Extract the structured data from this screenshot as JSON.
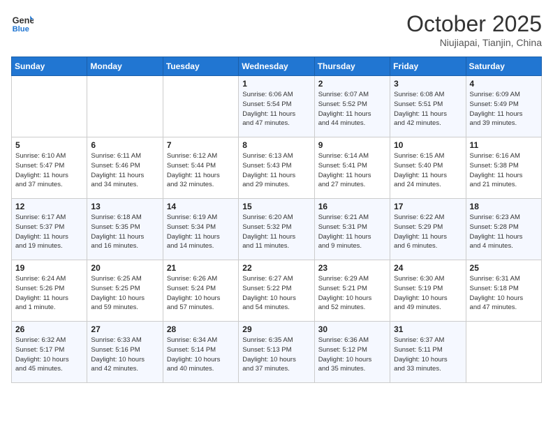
{
  "header": {
    "logo_line1": "General",
    "logo_line2": "Blue",
    "month_title": "October 2025",
    "subtitle": "Niujiapai, Tianjin, China"
  },
  "days_of_week": [
    "Sunday",
    "Monday",
    "Tuesday",
    "Wednesday",
    "Thursday",
    "Friday",
    "Saturday"
  ],
  "weeks": [
    [
      {
        "day": "",
        "info": ""
      },
      {
        "day": "",
        "info": ""
      },
      {
        "day": "",
        "info": ""
      },
      {
        "day": "1",
        "info": "Sunrise: 6:06 AM\nSunset: 5:54 PM\nDaylight: 11 hours\nand 47 minutes."
      },
      {
        "day": "2",
        "info": "Sunrise: 6:07 AM\nSunset: 5:52 PM\nDaylight: 11 hours\nand 44 minutes."
      },
      {
        "day": "3",
        "info": "Sunrise: 6:08 AM\nSunset: 5:51 PM\nDaylight: 11 hours\nand 42 minutes."
      },
      {
        "day": "4",
        "info": "Sunrise: 6:09 AM\nSunset: 5:49 PM\nDaylight: 11 hours\nand 39 minutes."
      }
    ],
    [
      {
        "day": "5",
        "info": "Sunrise: 6:10 AM\nSunset: 5:47 PM\nDaylight: 11 hours\nand 37 minutes."
      },
      {
        "day": "6",
        "info": "Sunrise: 6:11 AM\nSunset: 5:46 PM\nDaylight: 11 hours\nand 34 minutes."
      },
      {
        "day": "7",
        "info": "Sunrise: 6:12 AM\nSunset: 5:44 PM\nDaylight: 11 hours\nand 32 minutes."
      },
      {
        "day": "8",
        "info": "Sunrise: 6:13 AM\nSunset: 5:43 PM\nDaylight: 11 hours\nand 29 minutes."
      },
      {
        "day": "9",
        "info": "Sunrise: 6:14 AM\nSunset: 5:41 PM\nDaylight: 11 hours\nand 27 minutes."
      },
      {
        "day": "10",
        "info": "Sunrise: 6:15 AM\nSunset: 5:40 PM\nDaylight: 11 hours\nand 24 minutes."
      },
      {
        "day": "11",
        "info": "Sunrise: 6:16 AM\nSunset: 5:38 PM\nDaylight: 11 hours\nand 21 minutes."
      }
    ],
    [
      {
        "day": "12",
        "info": "Sunrise: 6:17 AM\nSunset: 5:37 PM\nDaylight: 11 hours\nand 19 minutes."
      },
      {
        "day": "13",
        "info": "Sunrise: 6:18 AM\nSunset: 5:35 PM\nDaylight: 11 hours\nand 16 minutes."
      },
      {
        "day": "14",
        "info": "Sunrise: 6:19 AM\nSunset: 5:34 PM\nDaylight: 11 hours\nand 14 minutes."
      },
      {
        "day": "15",
        "info": "Sunrise: 6:20 AM\nSunset: 5:32 PM\nDaylight: 11 hours\nand 11 minutes."
      },
      {
        "day": "16",
        "info": "Sunrise: 6:21 AM\nSunset: 5:31 PM\nDaylight: 11 hours\nand 9 minutes."
      },
      {
        "day": "17",
        "info": "Sunrise: 6:22 AM\nSunset: 5:29 PM\nDaylight: 11 hours\nand 6 minutes."
      },
      {
        "day": "18",
        "info": "Sunrise: 6:23 AM\nSunset: 5:28 PM\nDaylight: 11 hours\nand 4 minutes."
      }
    ],
    [
      {
        "day": "19",
        "info": "Sunrise: 6:24 AM\nSunset: 5:26 PM\nDaylight: 11 hours\nand 1 minute."
      },
      {
        "day": "20",
        "info": "Sunrise: 6:25 AM\nSunset: 5:25 PM\nDaylight: 10 hours\nand 59 minutes."
      },
      {
        "day": "21",
        "info": "Sunrise: 6:26 AM\nSunset: 5:24 PM\nDaylight: 10 hours\nand 57 minutes."
      },
      {
        "day": "22",
        "info": "Sunrise: 6:27 AM\nSunset: 5:22 PM\nDaylight: 10 hours\nand 54 minutes."
      },
      {
        "day": "23",
        "info": "Sunrise: 6:29 AM\nSunset: 5:21 PM\nDaylight: 10 hours\nand 52 minutes."
      },
      {
        "day": "24",
        "info": "Sunrise: 6:30 AM\nSunset: 5:19 PM\nDaylight: 10 hours\nand 49 minutes."
      },
      {
        "day": "25",
        "info": "Sunrise: 6:31 AM\nSunset: 5:18 PM\nDaylight: 10 hours\nand 47 minutes."
      }
    ],
    [
      {
        "day": "26",
        "info": "Sunrise: 6:32 AM\nSunset: 5:17 PM\nDaylight: 10 hours\nand 45 minutes."
      },
      {
        "day": "27",
        "info": "Sunrise: 6:33 AM\nSunset: 5:16 PM\nDaylight: 10 hours\nand 42 minutes."
      },
      {
        "day": "28",
        "info": "Sunrise: 6:34 AM\nSunset: 5:14 PM\nDaylight: 10 hours\nand 40 minutes."
      },
      {
        "day": "29",
        "info": "Sunrise: 6:35 AM\nSunset: 5:13 PM\nDaylight: 10 hours\nand 37 minutes."
      },
      {
        "day": "30",
        "info": "Sunrise: 6:36 AM\nSunset: 5:12 PM\nDaylight: 10 hours\nand 35 minutes."
      },
      {
        "day": "31",
        "info": "Sunrise: 6:37 AM\nSunset: 5:11 PM\nDaylight: 10 hours\nand 33 minutes."
      },
      {
        "day": "",
        "info": ""
      }
    ]
  ]
}
